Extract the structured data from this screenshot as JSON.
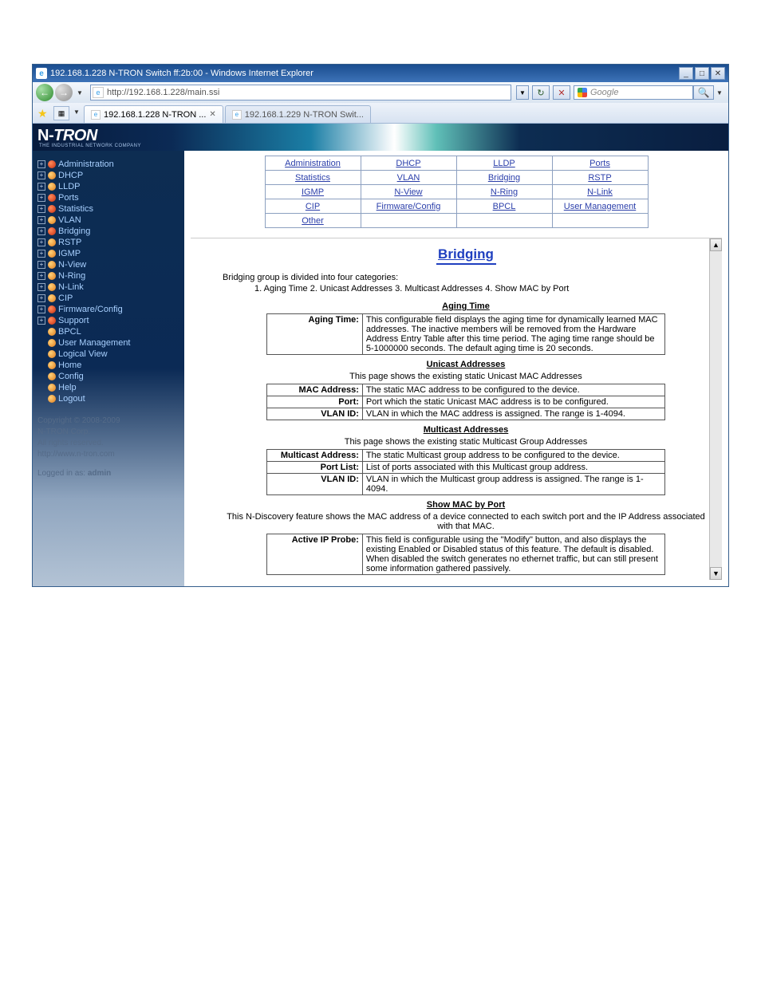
{
  "titlebar": {
    "text": "192.168.1.228 N-TRON Switch ff:2b:00 - Windows Internet Explorer"
  },
  "nav": {
    "url": "http://192.168.1.228/main.ssi",
    "search_placeholder": "Google"
  },
  "tabs": [
    {
      "label": "192.168.1.228 N-TRON ...",
      "active": true,
      "close": "✕"
    },
    {
      "label": "192.168.1.229 N-TRON Swit...",
      "active": false
    }
  ],
  "branding": {
    "logo": "N-TRON",
    "sub": "THE INDUSTRIAL NETWORK COMPANY"
  },
  "sidebar": {
    "items": [
      {
        "exp": "+",
        "bullet": "red",
        "label": "Administration"
      },
      {
        "exp": "+",
        "bullet": "orange",
        "label": "DHCP"
      },
      {
        "exp": "+",
        "bullet": "orange",
        "label": "LLDP"
      },
      {
        "exp": "+",
        "bullet": "red",
        "label": "Ports"
      },
      {
        "exp": "+",
        "bullet": "red",
        "label": "Statistics"
      },
      {
        "exp": "+",
        "bullet": "orange",
        "label": "VLAN"
      },
      {
        "exp": "+",
        "bullet": "red",
        "label": "Bridging"
      },
      {
        "exp": "+",
        "bullet": "orange",
        "label": "RSTP"
      },
      {
        "exp": "+",
        "bullet": "orange",
        "label": "IGMP"
      },
      {
        "exp": "+",
        "bullet": "orange",
        "label": "N-View"
      },
      {
        "exp": "+",
        "bullet": "orange",
        "label": "N-Ring"
      },
      {
        "exp": "+",
        "bullet": "orange",
        "label": "N-Link"
      },
      {
        "exp": "+",
        "bullet": "orange",
        "label": "CIP"
      },
      {
        "exp": "+",
        "bullet": "red",
        "label": "Firmware/Config"
      },
      {
        "exp": "+",
        "bullet": "red",
        "label": "Support"
      },
      {
        "exp": "",
        "bullet": "orange",
        "label": "BPCL"
      },
      {
        "exp": "",
        "bullet": "orange",
        "label": "User Management"
      },
      {
        "exp": "",
        "bullet": "orange",
        "label": "Logical View"
      },
      {
        "exp": "",
        "bullet": "orange",
        "label": "Home"
      },
      {
        "exp": "",
        "bullet": "orange",
        "label": "Config"
      },
      {
        "exp": "",
        "bullet": "orange",
        "label": "Help"
      },
      {
        "exp": "",
        "bullet": "orange",
        "label": "Logout"
      }
    ],
    "copyright": "Copyright © 2008-2009",
    "company": "N-TRON Corp.",
    "rights": "All rights reserved.",
    "url": "http://www.n-tron.com",
    "login_prefix": "Logged in as: ",
    "login_user": "admin"
  },
  "linkgrid": [
    [
      "Administration",
      "DHCP",
      "LLDP",
      "Ports"
    ],
    [
      "Statistics",
      "VLAN",
      "Bridging",
      "RSTP"
    ],
    [
      "IGMP",
      "N-View",
      "N-Ring",
      "N-Link"
    ],
    [
      "CIP",
      "Firmware/Config",
      "BPCL",
      "User Management"
    ],
    [
      "Other",
      "",
      "",
      ""
    ]
  ],
  "body": {
    "title": "Bridging",
    "intro": "Bridging group is divided into four categories:",
    "intro2": "1. Aging Time   2. Unicast Addresses   3. Multicast Addresses   4. Show MAC by Port",
    "aging": {
      "title": "Aging Time",
      "rows": [
        {
          "k": "Aging Time:",
          "v": "This configurable field displays the aging time for dynamically learned MAC addresses. The inactive members will be removed from the Hardware Address Entry Table after this time period. The aging time range should be 5-1000000 seconds. The default aging time is 20 seconds."
        }
      ]
    },
    "unicast": {
      "title": "Unicast Addresses",
      "desc": "This page shows the existing static Unicast MAC Addresses",
      "rows": [
        {
          "k": "MAC Address:",
          "v": "The static MAC address to be configured to the device."
        },
        {
          "k": "Port:",
          "v": "Port which the static Unicast MAC address is to be configured."
        },
        {
          "k": "VLAN ID:",
          "v": "VLAN in which the MAC address is assigned. The range is 1-4094."
        }
      ]
    },
    "multicast": {
      "title": "Multicast Addresses",
      "desc": "This page shows the existing static Multicast Group Addresses",
      "rows": [
        {
          "k": "Multicast Address:",
          "v": "The static Multicast group address to be configured to the device."
        },
        {
          "k": "Port List:",
          "v": "List of ports associated with this Multicast group address."
        },
        {
          "k": "VLAN ID:",
          "v": "VLAN in which the Multicast group address is assigned. The range is 1-4094."
        }
      ]
    },
    "showmac": {
      "title": "Show MAC by Port",
      "desc": "This N-Discovery feature shows the MAC address of a device connected to each switch port and the IP Address associated with that MAC.",
      "rows": [
        {
          "k": "Active IP Probe:",
          "v": "This field is configurable using the \"Modify\" button, and also displays the existing Enabled or Disabled status of this feature. The default is disabled. When disabled the switch generates no ethernet traffic, but can still present some information gathered passively."
        }
      ]
    }
  }
}
